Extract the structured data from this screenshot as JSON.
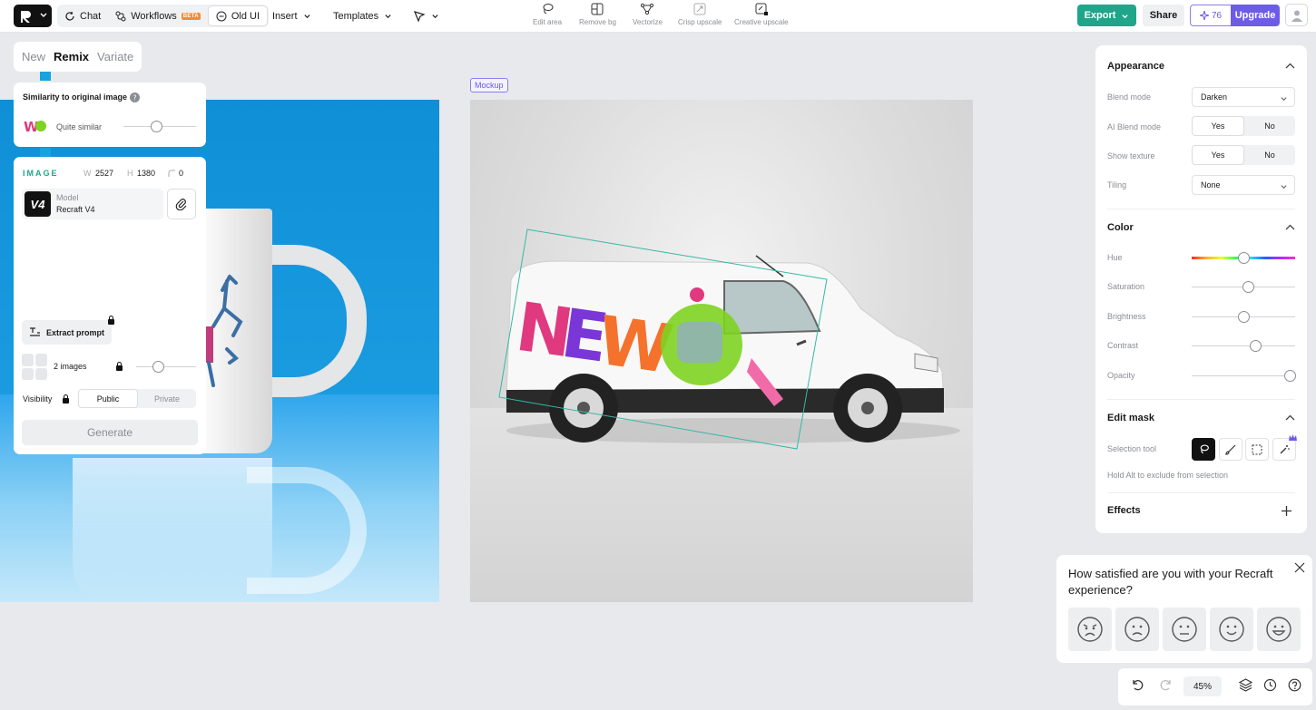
{
  "topbar": {
    "chat": "Chat",
    "workflows": "Workflows",
    "beta": "BETA",
    "old_ui": "Old UI",
    "insert": "Insert",
    "templates": "Templates",
    "tools": [
      "Edit area",
      "Remove bg",
      "Vectorize",
      "Crisp upscale",
      "Creative upscale"
    ],
    "export": "Export",
    "share": "Share",
    "credits": "76",
    "upgrade": "Upgrade"
  },
  "left": {
    "tabs": [
      "New",
      "Remix",
      "Variate"
    ],
    "active_tab": "Remix",
    "similarity_title": "Similarity to original image",
    "similarity_value": "Quite similar",
    "image_label": "IMAGE",
    "w_label": "W",
    "w": "2527",
    "h_label": "H",
    "h": "1380",
    "radius": "0",
    "model_label": "Model",
    "model_name": "Recraft V4",
    "model_badge": "V4",
    "extract": "Extract prompt",
    "images_count": "2 images",
    "visibility": "Visibility",
    "public": "Public",
    "private": "Private",
    "generate": "Generate"
  },
  "canvas": {
    "mockup_tag": "Mockup"
  },
  "right": {
    "appearance": "Appearance",
    "blend_mode_label": "Blend mode",
    "blend_mode": "Darken",
    "ai_blend_label": "AI Blend mode",
    "yes": "Yes",
    "no": "No",
    "texture_label": "Show texture",
    "tiling_label": "Tiling",
    "tiling": "None",
    "color": "Color",
    "hue": "Hue",
    "saturation": "Saturation",
    "brightness": "Brightness",
    "contrast": "Contrast",
    "opacity": "Opacity",
    "edit_mask": "Edit mask",
    "selection_tool": "Selection tool",
    "hint": "Hold Alt to exclude from selection",
    "effects": "Effects"
  },
  "survey": {
    "question": "How satisfied are you with your Recraft experience?"
  },
  "bottom": {
    "zoom": "45%"
  },
  "colors": {
    "accent": "#1fa58a",
    "upgrade": "#6d5ce8",
    "beta": "#f28c38"
  }
}
